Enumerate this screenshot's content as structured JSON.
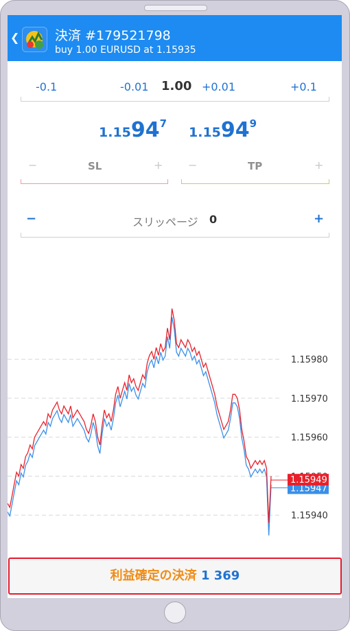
{
  "header": {
    "title": "決済 #179521798",
    "subtitle": "buy 1.00 EURUSD at 1.15935"
  },
  "volume": {
    "minus_large": "-0.1",
    "minus_small": "-0.01",
    "value": "1.00",
    "plus_small": "+0.01",
    "plus_large": "+0.1"
  },
  "quotes": {
    "bid": {
      "prefix": "1.15",
      "big": "94",
      "sup": "7"
    },
    "ask": {
      "prefix": "1.15",
      "big": "94",
      "sup": "9"
    }
  },
  "stop_loss": {
    "label": "SL",
    "minus": "−",
    "plus": "+"
  },
  "take_profit": {
    "label": "TP",
    "minus": "−",
    "plus": "+"
  },
  "slippage": {
    "label": "スリッページ",
    "value": "0",
    "minus": "−",
    "plus": "+"
  },
  "chart_data": {
    "type": "line",
    "y_ticks": [
      "1.15980",
      "1.15970",
      "1.15960",
      "1.15950",
      "1.15940"
    ],
    "ylim": [
      1.1593,
      1.16004
    ],
    "series": [
      {
        "role": "ask",
        "color": "#e8202a",
        "last_label": "1.15949"
      },
      {
        "role": "bid",
        "color": "#3a8fe8",
        "last_label": "1.15947"
      }
    ],
    "ask_values": [
      1.15943,
      1.15942,
      1.15945,
      1.15948,
      1.15951,
      1.1595,
      1.15953,
      1.15952,
      1.15955,
      1.15956,
      1.15958,
      1.15957,
      1.1596,
      1.15961,
      1.15962,
      1.15963,
      1.15964,
      1.15963,
      1.15966,
      1.15965,
      1.15967,
      1.15968,
      1.15969,
      1.15967,
      1.15966,
      1.15968,
      1.15967,
      1.15966,
      1.15968,
      1.15965,
      1.15966,
      1.15967,
      1.15966,
      1.15965,
      1.15964,
      1.15962,
      1.15961,
      1.15963,
      1.15966,
      1.15964,
      1.1596,
      1.15958,
      1.15963,
      1.15967,
      1.15965,
      1.15966,
      1.15964,
      1.15967,
      1.15971,
      1.15973,
      1.1597,
      1.15972,
      1.15974,
      1.15972,
      1.15976,
      1.15974,
      1.15975,
      1.15973,
      1.15972,
      1.15974,
      1.15976,
      1.15975,
      1.15979,
      1.15981,
      1.15982,
      1.1598,
      1.15983,
      1.15981,
      1.15984,
      1.15982,
      1.15983,
      1.15988,
      1.15985,
      1.15993,
      1.1599,
      1.15984,
      1.15983,
      1.15985,
      1.15984,
      1.15983,
      1.15985,
      1.15984,
      1.15982,
      1.15983,
      1.15981,
      1.15982,
      1.1598,
      1.15978,
      1.15979,
      1.15977,
      1.15975,
      1.15973,
      1.15971,
      1.15968,
      1.15966,
      1.15964,
      1.15962,
      1.15963,
      1.15964,
      1.15967,
      1.15971,
      1.15971,
      1.1597,
      1.15967,
      1.15962,
      1.15959,
      1.15955,
      1.15954,
      1.15952,
      1.15953,
      1.15954,
      1.15953,
      1.15954,
      1.15953,
      1.15954,
      1.15952,
      1.15938,
      1.1595
    ]
  },
  "footer": {
    "close_label": "利益確定の決済",
    "profit": "1 369"
  }
}
